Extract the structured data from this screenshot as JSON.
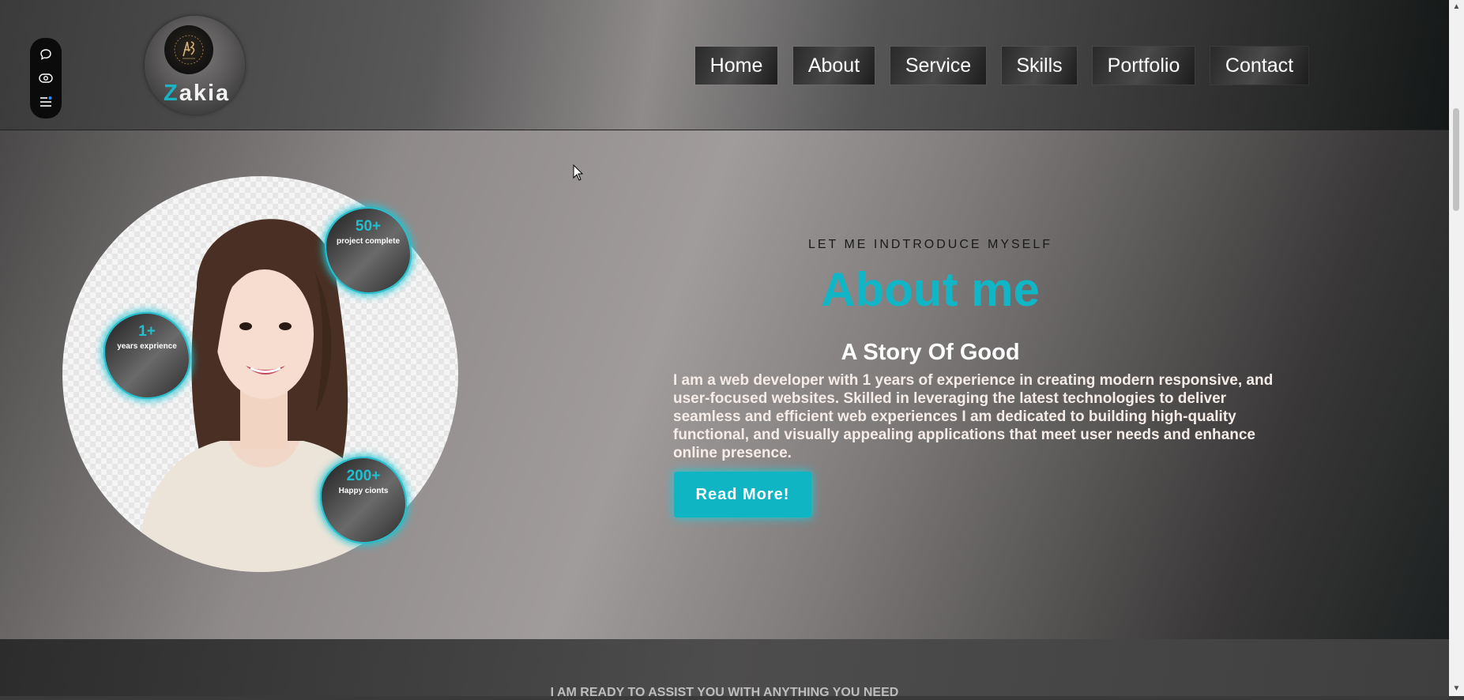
{
  "toolbar": {
    "icons": [
      "chat-icon",
      "eye-icon",
      "menu-icon"
    ]
  },
  "logo": {
    "initial": "Z",
    "rest": "akia"
  },
  "nav": {
    "items": [
      {
        "label": "Home"
      },
      {
        "label": "About"
      },
      {
        "label": "Service"
      },
      {
        "label": "Skills"
      },
      {
        "label": "Portfolio"
      },
      {
        "label": "Contact"
      }
    ]
  },
  "about": {
    "kicker": "LET ME INDTRODUCE MYSELF",
    "title": "About me",
    "subtitle": "A Story Of Good",
    "text": "I am a web developer with 1 years of experience in creating modern responsive, and user-focused websites. Skilled in leveraging the latest technologies to deliver seamless and efficient web experiences I am dedicated to building high-quality functional, and visually appealing applications that meet user needs and enhance online presence.",
    "button": "Read More!"
  },
  "stats": [
    {
      "value": "50+",
      "label": "project complete"
    },
    {
      "value": "1+",
      "label": "years exprience"
    },
    {
      "value": "200+",
      "label": "Happy cionts"
    }
  ],
  "next_section": {
    "heading": "I AM READY TO ASSIST YOU WITH ANYTHING YOU NEED"
  },
  "colors": {
    "accent": "#10b6c6",
    "text_light": "#f5ece8",
    "toolbar_bg": "#0b0b0b"
  }
}
